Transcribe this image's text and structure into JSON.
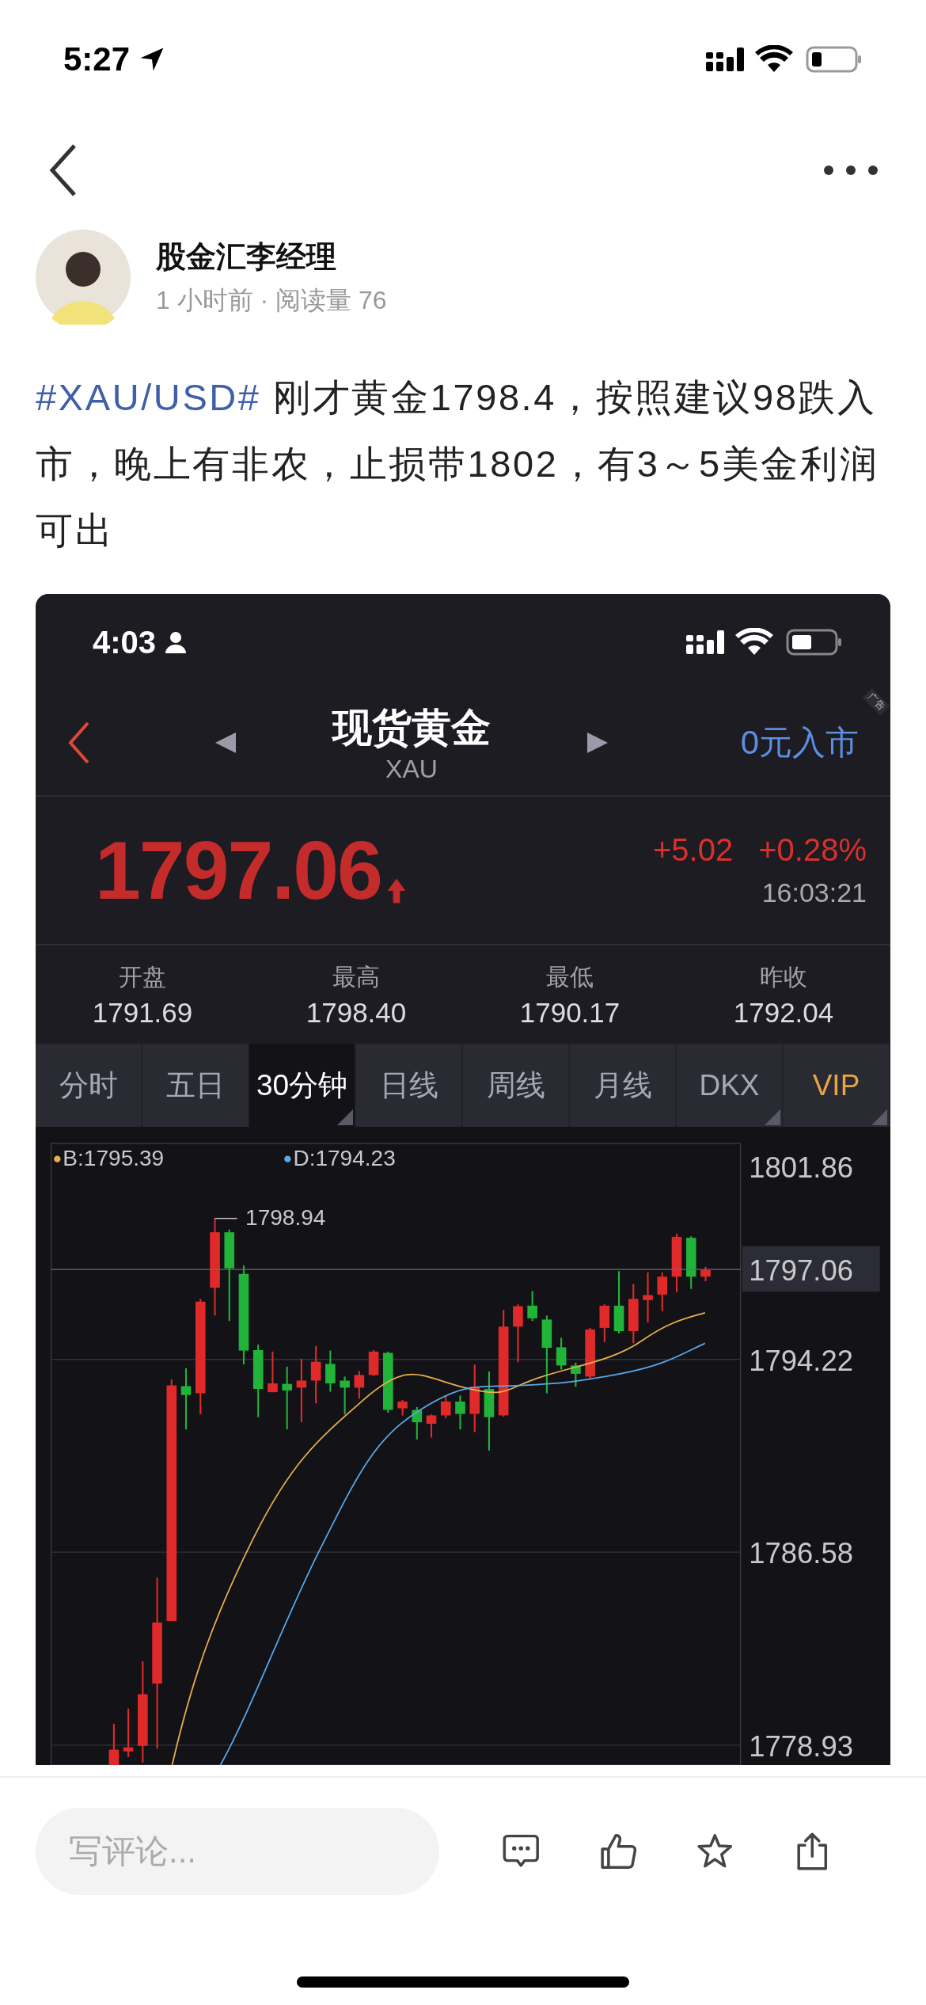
{
  "status_bar": {
    "time": "5:27"
  },
  "author": {
    "name": "股金汇李经理",
    "meta": "1 小时前 · 阅读量 76"
  },
  "post": {
    "hashtag": "#XAU/USD#",
    "text": " 刚才黄金1798.4，按照建议98跌入市，晚上有非农，止损带1802，有3～5美金利润可出"
  },
  "embedded_screen": {
    "status_bar": {
      "time": "4:03"
    },
    "header": {
      "title": "现货黄金",
      "subtitle": "XAU",
      "action": "0元入市",
      "ad_badge": "广告"
    },
    "quote": {
      "price": "1797.06",
      "change": "+5.02",
      "change_percent": "+0.28%",
      "time": "16:03:21",
      "rising": true
    },
    "stats": [
      {
        "label": "开盘",
        "value": "1791.69"
      },
      {
        "label": "最高",
        "value": "1798.40"
      },
      {
        "label": "最低",
        "value": "1790.17"
      },
      {
        "label": "昨收",
        "value": "1792.04"
      }
    ],
    "tabs": [
      {
        "label": "分时",
        "selected": false,
        "dropdown": false,
        "kind": "plain"
      },
      {
        "label": "五日",
        "selected": false,
        "dropdown": false,
        "kind": "plain"
      },
      {
        "label": "30分钟",
        "selected": true,
        "dropdown": true,
        "kind": "plain"
      },
      {
        "label": "日线",
        "selected": false,
        "dropdown": false,
        "kind": "plain"
      },
      {
        "label": "周线",
        "selected": false,
        "dropdown": false,
        "kind": "plain"
      },
      {
        "label": "月线",
        "selected": false,
        "dropdown": false,
        "kind": "plain"
      },
      {
        "label": "DKX",
        "selected": false,
        "dropdown": true,
        "kind": "plain"
      },
      {
        "label": "VIP",
        "selected": false,
        "dropdown": true,
        "kind": "vip"
      }
    ],
    "chart": {
      "legend": [
        {
          "label": "B:1795.39",
          "color": "#e8b04a"
        },
        {
          "label": "D:1794.23",
          "color": "#5aa8e8"
        }
      ],
      "price_tag": "1797.06",
      "chart_data": {
        "type": "candlestick",
        "grid": true,
        "ohlc": [
          [
            1778.13,
            1779.78,
            1778.13,
            1778.75
          ],
          [
            1778.68,
            1780.38,
            1778.46,
            1778.84
          ],
          [
            1778.9,
            1782.25,
            1778.24,
            1780.95
          ],
          [
            1781.37,
            1785.57,
            1778.79,
            1783.79
          ],
          [
            1783.85,
            1793.43,
            1783.85,
            1793.19
          ],
          [
            1793.16,
            1793.87,
            1791.45,
            1792.81
          ],
          [
            1792.88,
            1796.62,
            1792.04,
            1796.51
          ],
          [
            1797.06,
            1799.81,
            1795.96,
            1799.26
          ],
          [
            1799.26,
            1799.37,
            1795.74,
            1797.83
          ],
          [
            1797.61,
            1797.94,
            1794.02,
            1794.57
          ],
          [
            1794.59,
            1794.81,
            1791.93,
            1793.05
          ],
          [
            1792.92,
            1794.53,
            1792.92,
            1793.27
          ],
          [
            1793.25,
            1793.93,
            1791.45,
            1792.99
          ],
          [
            1793.1,
            1794.24,
            1791.73,
            1793.38
          ],
          [
            1793.38,
            1794.75,
            1792.48,
            1794.13
          ],
          [
            1794.04,
            1794.57,
            1792.94,
            1793.27
          ],
          [
            1793.38,
            1793.54,
            1792.04,
            1793.1
          ],
          [
            1793.1,
            1793.76,
            1792.66,
            1793.6
          ],
          [
            1793.6,
            1794.59,
            1793.56,
            1794.53
          ],
          [
            1794.48,
            1794.53,
            1792.11,
            1792.22
          ],
          [
            1792.28,
            1792.61,
            1792.0,
            1792.55
          ],
          [
            1792.22,
            1792.33,
            1791.05,
            1791.73
          ],
          [
            1791.67,
            1792.04,
            1791.12,
            1792.0
          ],
          [
            1792.0,
            1792.79,
            1791.89,
            1792.55
          ],
          [
            1792.55,
            1792.79,
            1791.45,
            1792.06
          ],
          [
            1792.06,
            1794.02,
            1791.34,
            1793.14
          ],
          [
            1793.05,
            1793.74,
            1790.61,
            1791.93
          ],
          [
            1792.0,
            1796.18,
            1791.95,
            1795.52
          ],
          [
            1795.52,
            1796.4,
            1794.11,
            1796.33
          ],
          [
            1796.35,
            1796.93,
            1795.74,
            1795.85
          ],
          [
            1795.8,
            1795.96,
            1792.88,
            1794.68
          ],
          [
            1794.7,
            1795.08,
            1793.82,
            1793.98
          ],
          [
            1793.98,
            1794.09,
            1793.14,
            1793.65
          ],
          [
            1793.54,
            1795.47,
            1793.43,
            1795.41
          ],
          [
            1795.47,
            1796.4,
            1794.9,
            1796.35
          ],
          [
            1796.35,
            1797.72,
            1795.25,
            1795.34
          ],
          [
            1795.34,
            1797.21,
            1794.86,
            1796.62
          ],
          [
            1796.57,
            1797.67,
            1795.69,
            1796.77
          ],
          [
            1796.79,
            1797.67,
            1796.13,
            1797.5
          ],
          [
            1797.5,
            1799.21,
            1796.88,
            1799.08
          ],
          [
            1799.04,
            1799.1,
            1797.01,
            1797.5
          ],
          [
            1797.5,
            1797.89,
            1797.32,
            1797.76
          ]
        ],
        "ylim": [
          1778.14,
          1802.78
        ],
        "yticks": [
          {
            "value": 1801.86,
            "label": "1801.86"
          },
          {
            "value": 1794.22,
            "label": "1794.22"
          },
          {
            "value": 1786.58,
            "label": "1786.58"
          },
          {
            "value": 1778.93,
            "label": "1778.93"
          }
        ],
        "annotations": [
          "1798.94"
        ]
      }
    }
  },
  "comment_bar": {
    "placeholder": "写评论..."
  }
}
